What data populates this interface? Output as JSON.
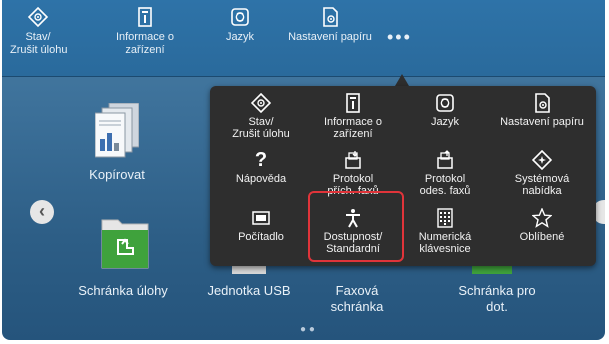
{
  "topbar": {
    "items": [
      {
        "label": "Stav/\nZrušit úlohu",
        "icon": "status-cancel-icon"
      },
      {
        "label": "Informace o\nzařízení",
        "icon": "device-info-icon"
      },
      {
        "label": "Jazyk",
        "icon": "language-icon"
      },
      {
        "label": "Nastavení papíru",
        "icon": "paper-settings-icon"
      }
    ],
    "more_label": "•••"
  },
  "home": {
    "tiles": [
      {
        "label": "Kopírovat",
        "icon": "copy-icon"
      },
      {
        "label": "Schránka úlohy",
        "icon": "job-box-icon"
      },
      {
        "label": "Jednotka USB",
        "icon": "usb-drive-icon"
      },
      {
        "label": "Faxová\nschránka",
        "icon": "fax-box-icon"
      },
      {
        "label": "Schránka pro\ndot.",
        "icon": "polling-box-icon"
      }
    ],
    "prev_arrow": "‹",
    "pager": "● ●"
  },
  "popup": {
    "items": [
      {
        "label": "Stav/\nZrušit úlohu",
        "icon": "status-cancel-icon"
      },
      {
        "label": "Informace o\nzařízení",
        "icon": "device-info-icon"
      },
      {
        "label": "Jazyk",
        "icon": "language-icon"
      },
      {
        "label": "Nastavení papíru",
        "icon": "paper-settings-icon"
      },
      {
        "label": "Nápověda",
        "icon": "help-icon"
      },
      {
        "label": "Protokol\npřích. faxů",
        "icon": "fax-rx-log-icon"
      },
      {
        "label": "Protokol\nodes. faxů",
        "icon": "fax-tx-log-icon"
      },
      {
        "label": "Systémová\nnabídka",
        "icon": "system-menu-icon"
      },
      {
        "label": "Počítadlo",
        "icon": "counter-icon"
      },
      {
        "label": "Dostupnost/\nStandardní",
        "icon": "accessibility-icon"
      },
      {
        "label": "Numerická\nklávesnice",
        "icon": "numeric-keypad-icon"
      },
      {
        "label": "Oblíbené",
        "icon": "favorites-icon"
      }
    ]
  },
  "colors": {
    "topbar": "#2a6a9c",
    "background": "#3b6f98",
    "popup": "#2e2e2e",
    "highlight": "#e0343a"
  }
}
